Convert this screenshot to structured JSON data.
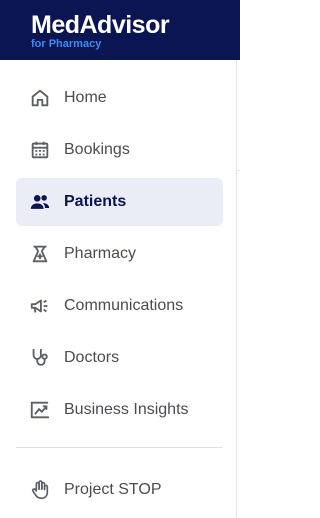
{
  "brand": {
    "name": "MedAdvisor",
    "subtitle": "for Pharmacy"
  },
  "nav": {
    "items": [
      {
        "label": "Home",
        "icon": "home-icon",
        "active": false
      },
      {
        "label": "Bookings",
        "icon": "calendar-icon",
        "active": false
      },
      {
        "label": "Patients",
        "icon": "people-icon",
        "active": true
      },
      {
        "label": "Pharmacy",
        "icon": "pharmacy-icon",
        "active": false
      },
      {
        "label": "Communications",
        "icon": "megaphone-icon",
        "active": false
      },
      {
        "label": "Doctors",
        "icon": "stethoscope-icon",
        "active": false
      },
      {
        "label": "Business Insights",
        "icon": "chart-icon",
        "active": false
      }
    ],
    "secondary": [
      {
        "label": "Project STOP",
        "icon": "hand-icon",
        "active": false
      }
    ]
  },
  "colors": {
    "header_bg": "#0b1552",
    "brand_sub": "#3f8cf5",
    "active_bg": "#eaedf5"
  }
}
